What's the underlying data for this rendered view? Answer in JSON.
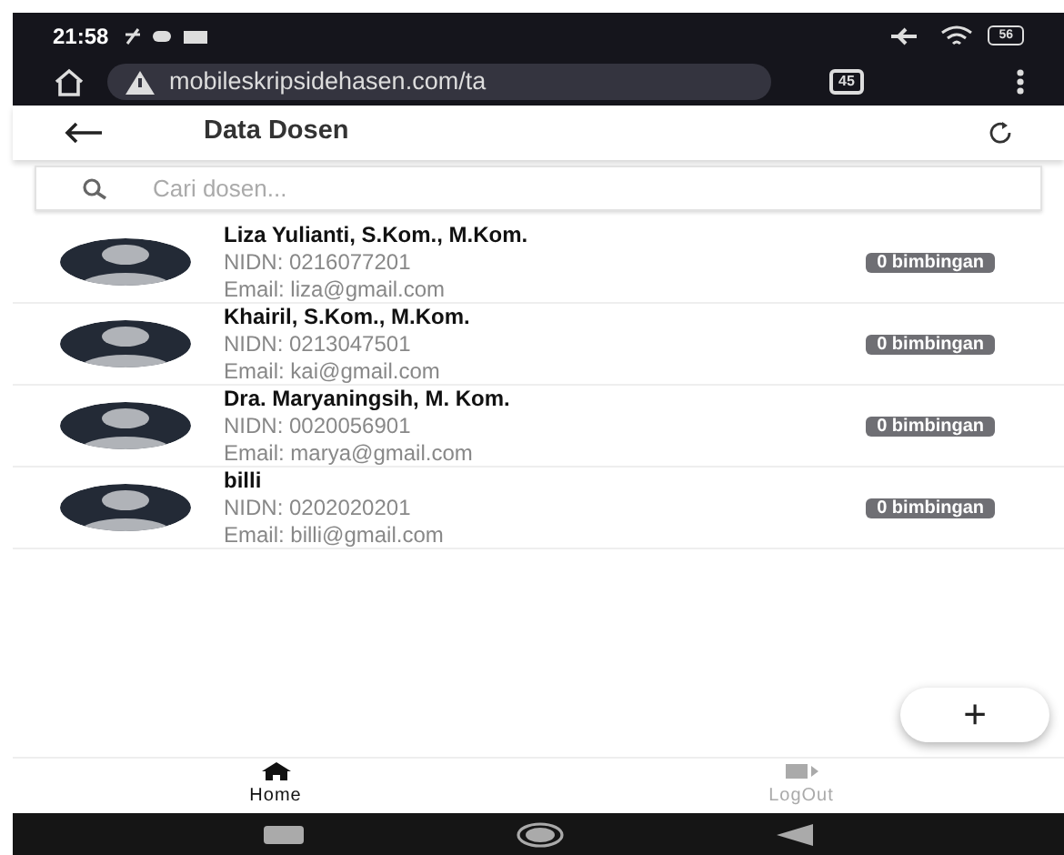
{
  "status_bar": {
    "time": "21:58",
    "battery": "56"
  },
  "browser": {
    "url": "mobileskripsidehasen.com/ta",
    "tab_count": "45"
  },
  "header": {
    "title": "Data Dosen"
  },
  "search": {
    "placeholder": "Cari dosen..."
  },
  "lecturers": [
    {
      "name": "Liza Yulianti, S.Kom., M.Kom.",
      "nidn": "NIDN: 0216077201",
      "email": "Email: liza@gmail.com",
      "badge": "0 bimbingan"
    },
    {
      "name": "Khairil, S.Kom., M.Kom.",
      "nidn": "NIDN: 0213047501",
      "email": "Email: kai@gmail.com",
      "badge": "0 bimbingan"
    },
    {
      "name": "Dra. Maryaningsih, M. Kom.",
      "nidn": "NIDN: 0020056901",
      "email": "Email: marya@gmail.com",
      "badge": "0 bimbingan"
    },
    {
      "name": "billi",
      "nidn": "NIDN: 0202020201",
      "email": "Email: billi@gmail.com",
      "badge": "0 bimbingan"
    }
  ],
  "fab": {
    "label": "+"
  },
  "bottom_nav": [
    {
      "label": "Home",
      "kind": "home",
      "selected": true
    },
    {
      "label": "LogOut",
      "kind": "logout",
      "selected": false
    }
  ]
}
